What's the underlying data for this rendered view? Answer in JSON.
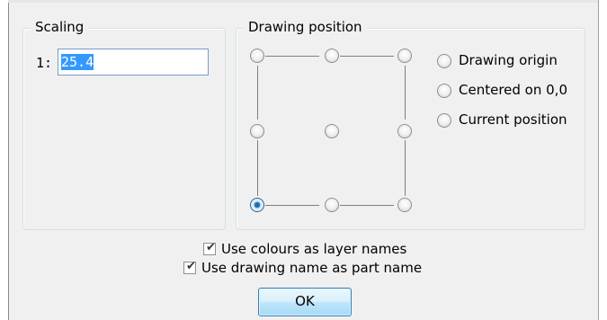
{
  "scaling": {
    "title": "Scaling",
    "prefix": "1:",
    "value": "25.4"
  },
  "drawing_position": {
    "title": "Drawing position",
    "selected_grid_point": "bottom-left",
    "options": [
      {
        "label": "Drawing origin",
        "checked": false
      },
      {
        "label": "Centered on 0,0",
        "checked": false
      },
      {
        "label": "Current position",
        "checked": false
      }
    ]
  },
  "options": {
    "use_colours": {
      "label": "Use colours as layer names",
      "checked": true
    },
    "use_drawing_name": {
      "label": "Use drawing name as part name",
      "checked": true
    }
  },
  "ok_label": "OK"
}
